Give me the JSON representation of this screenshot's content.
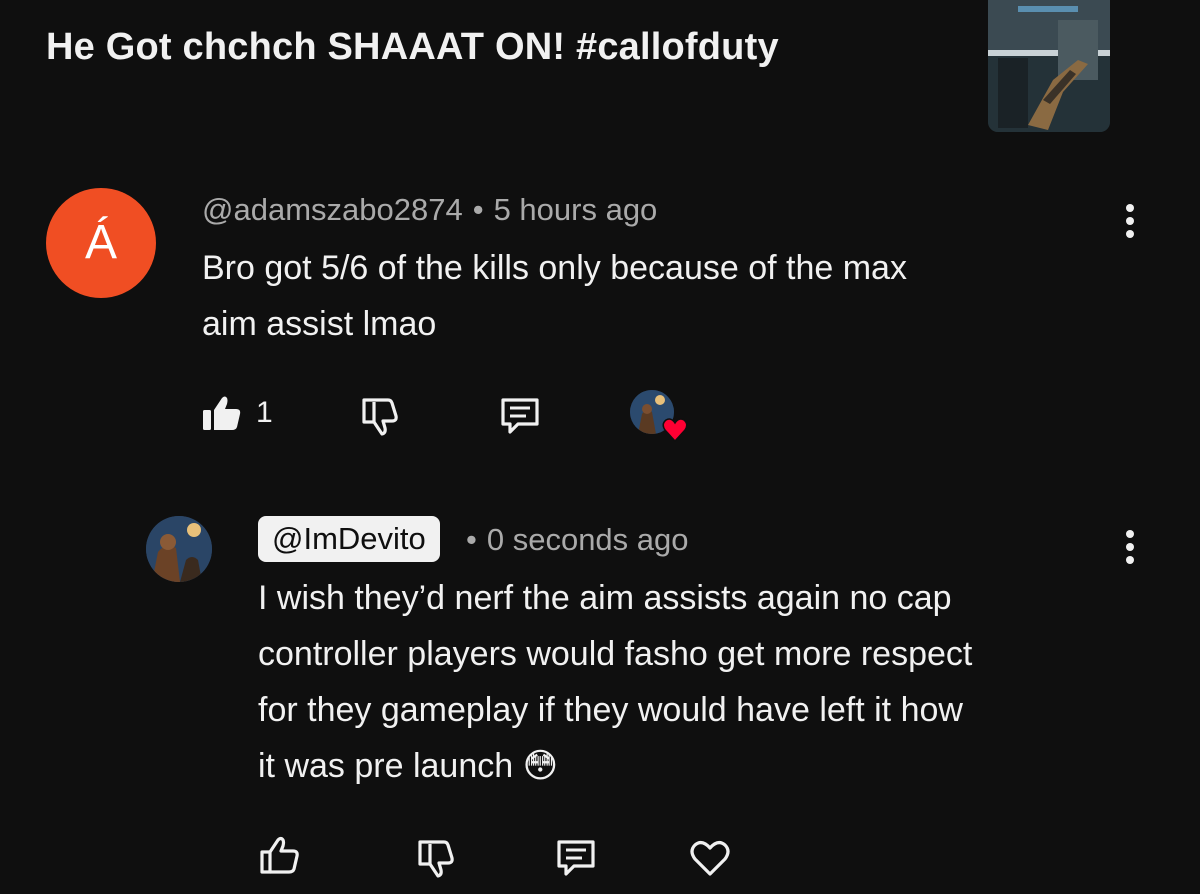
{
  "video": {
    "title": "He Got chchch SHAAAT ON! #callofduty",
    "thumbnail_icon": "gameplay-thumbnail"
  },
  "comment": {
    "avatar_letter": "Á",
    "avatar_color": "#f04e23",
    "author": "@adamszabo2874",
    "separator": "•",
    "time": "5 hours ago",
    "text_line1": "Bro got 5/6 of the kills only because of the max",
    "text_line2": "aim assist lmao",
    "like_count": "1",
    "icons": [
      "thumbs-up-filled-icon",
      "thumbs-down-icon",
      "reply-icon",
      "creator-heart-icon",
      "more-vert-icon"
    ]
  },
  "reply": {
    "author": "@ImDevito",
    "separator": "•",
    "time": "0 seconds ago",
    "text_line1": "I wish they’d nerf the aim assists again no cap",
    "text_line2": "controller players would fasho get more respect",
    "text_line3": "for they gameplay if they would have left it how",
    "text_line4": "it was pre launch",
    "emoji": "😳",
    "icons": [
      "thumbs-up-icon",
      "thumbs-down-icon",
      "reply-icon",
      "heart-icon",
      "more-vert-icon"
    ]
  },
  "colors": {
    "background": "#0f0f0f",
    "secondary_text": "#aaaaaa",
    "heart_red": "#ff0033"
  }
}
